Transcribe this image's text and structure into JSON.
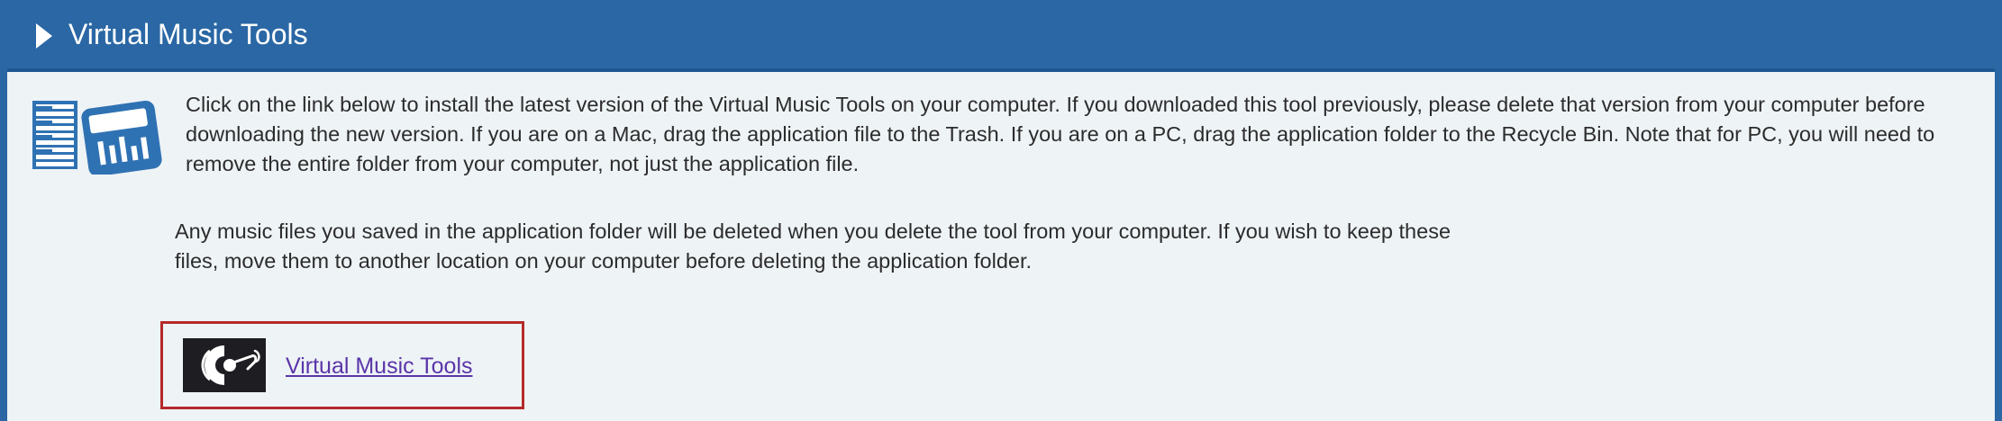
{
  "header": {
    "title": "Virtual Music Tools"
  },
  "content": {
    "instructions": "Click on the link below to install the latest version of the Virtual Music Tools on your computer. If you downloaded this tool previously, please delete that version from your computer before downloading the new version. If you are on a Mac, drag the application file to the Trash. If you are on a PC, drag the application folder to the Recycle Bin. Note that for PC, you will need to remove the entire folder from your computer, not just the application file.",
    "warning": "Any music files you saved in the application folder will be deleted when you delete the tool from your computer. If you wish to keep these files, move them to another location on your computer before deleting the application folder."
  },
  "download": {
    "link_label": "Virtual Music Tools"
  },
  "icons": {
    "section_icon": "music-tools-icon",
    "app_icon": "virtual-music-tools-app-icon"
  },
  "colors": {
    "header_bg": "#2a67a4",
    "panel_bg": "#eef3f6",
    "highlight_border": "#b52a2a",
    "link": "#5a35a8",
    "icon_blue": "#2f72b3"
  }
}
